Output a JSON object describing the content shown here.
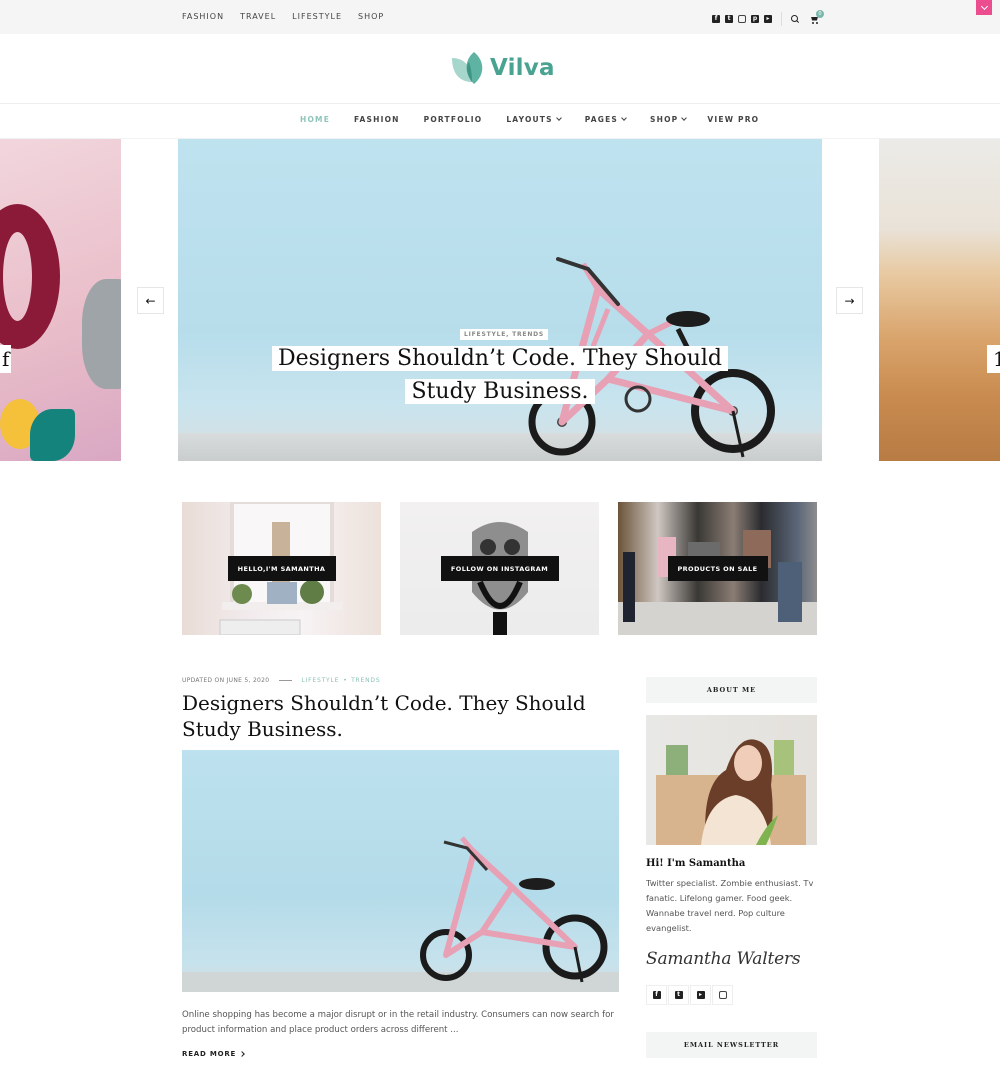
{
  "topbar": {
    "nav": [
      "FASHION",
      "TRAVEL",
      "LIFESTYLE",
      "SHOP"
    ],
    "social_icons": [
      "facebook-icon",
      "twitter-icon",
      "instagram-icon",
      "pinterest-icon",
      "youtube-icon"
    ],
    "cart_count": "0"
  },
  "brand": {
    "name": "Vilva",
    "accent_color": "#4aa291",
    "accent_light": "#8fc4bb",
    "toggle_color": "#ec4d8f"
  },
  "mainnav": {
    "items": [
      {
        "label": "HOME",
        "active": true,
        "dropdown": false
      },
      {
        "label": "FASHION",
        "active": false,
        "dropdown": false
      },
      {
        "label": "PORTFOLIO",
        "active": false,
        "dropdown": false
      },
      {
        "label": "LAYOUTS",
        "active": false,
        "dropdown": true
      },
      {
        "label": "PAGES",
        "active": false,
        "dropdown": true
      },
      {
        "label": "SHOP",
        "active": false,
        "dropdown": true
      },
      {
        "label": "VIEW PRO",
        "active": false,
        "dropdown": false
      }
    ]
  },
  "slider": {
    "prev_arrow": "←",
    "next_arrow": "→",
    "left_peek_text": "f",
    "right_peek_text": "1",
    "current": {
      "categories": "LIFESTYLE,  TRENDS",
      "title_line1": "Designers Shouldn’t Code. They Should",
      "title_line2": "Study Business."
    }
  },
  "promos": [
    {
      "label": "HELLO,I'M SAMANTHA"
    },
    {
      "label": "FOLLOW ON INSTAGRAM"
    },
    {
      "label": "PRODUCTS ON SALE"
    }
  ],
  "post": {
    "date": "UPDATED ON JUNE 5, 2020",
    "categories": [
      "LIFESTYLE",
      "TRENDS"
    ],
    "title": "Designers Shouldn’t Code. They Should Study Business.",
    "excerpt": "Online shopping has become a major disrupt or in the retail industry. Consumers can now search for product information and place product orders across different ...",
    "read_more": "READ MORE"
  },
  "sidebar": {
    "about_title": "ABOUT ME",
    "name": "Hi! I'm Samantha",
    "bio": "Twitter specialist. Zombie enthusiast. Tv fanatic. Lifelong gamer. Food geek. Wannabe travel nerd. Pop culture evangelist.",
    "signature": "Samantha Walters",
    "social_icons": [
      "facebook-icon",
      "twitter-icon",
      "youtube-icon",
      "instagram-icon"
    ],
    "newsletter_title": "EMAIL NEWSLETTER"
  }
}
